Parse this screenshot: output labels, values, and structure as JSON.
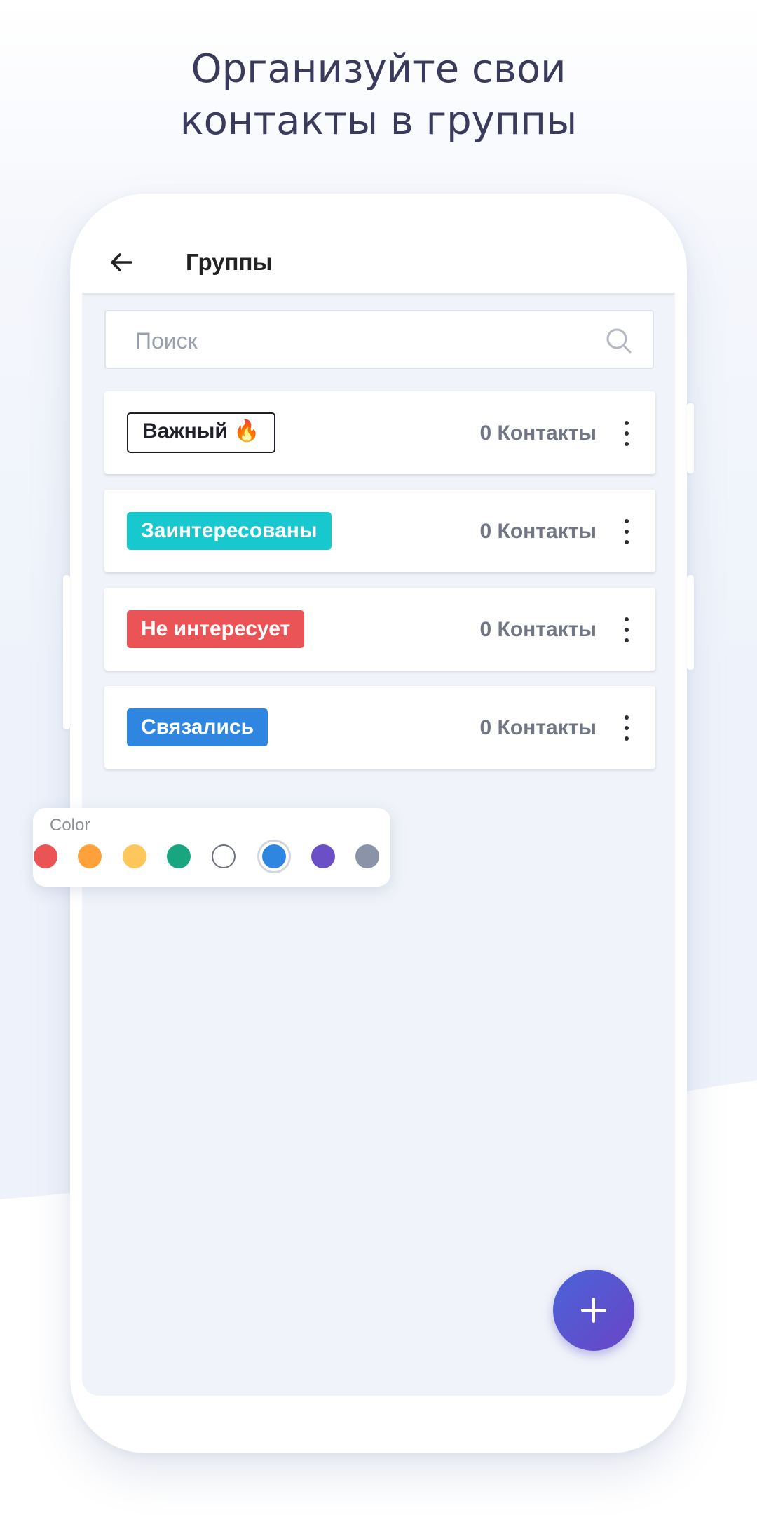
{
  "headline": {
    "line1": "Организуйте свои",
    "line2": "контакты в группы"
  },
  "appbar": {
    "title": "Группы",
    "back_icon": "arrow-left-icon"
  },
  "search": {
    "placeholder": "Поиск",
    "value": "",
    "icon": "search-icon"
  },
  "groups": [
    {
      "name": "Важный 🔥",
      "count": "0 Контакты",
      "color": "#ffffff",
      "style": "outlined"
    },
    {
      "name": "Заинтересованы",
      "count": "0 Контакты",
      "color": "#17c8cf",
      "style": "filled"
    },
    {
      "name": "Не интересует",
      "count": "0 Контакты",
      "color": "#eb5457",
      "style": "filled"
    },
    {
      "name": "Связались",
      "count": "0 Контакты",
      "color": "#2f86e0",
      "style": "filled"
    }
  ],
  "color_picker": {
    "label": "Color",
    "colors": [
      "#ea5455",
      "#fea13b",
      "#fdc75c",
      "#18a57f",
      "#ffffff",
      "#2f86e0",
      "#6b4fc7",
      "#8a93a8"
    ],
    "selected": "#2f86e0"
  },
  "fab": {
    "icon": "plus-icon"
  }
}
